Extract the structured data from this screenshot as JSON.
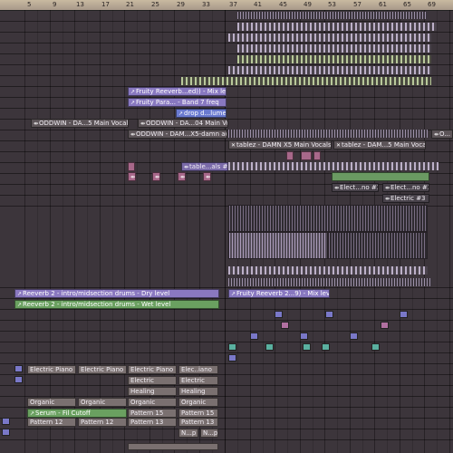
{
  "ruler": {
    "ticks": [
      "5",
      "9",
      "13",
      "17",
      "21",
      "25",
      "29",
      "33",
      "37",
      "41",
      "45",
      "49",
      "53",
      "57",
      "61",
      "65",
      "69"
    ]
  },
  "clips": {
    "mix_level_top": "Fruity Reeverb...ed)) - Mix level",
    "band7": "Fruity Para... - Band 7 freq",
    "drop_volume": "drop d...lume",
    "main_vocals_a": "ODDWIN - DA...5 Main Vocals",
    "main_vocals_b": "ODDWIN - DA...04 Main Vocals",
    "adlibs": "ODDWIN - DAM...X5-damn adlibs",
    "adlibs_end": "O...",
    "tablez_a": "tablez - DAMN X5 Main Vocals",
    "tablez_b": "tablez - DAM...5 Main Vocals",
    "table_als": "table...als #2",
    "elect_no3_a": "Elect...no #3",
    "elect_no3_b": "Elect...no #3",
    "electric3": "Electric #3",
    "dry_level": "Reeverb 2 - intro/midsection drums - Dry level",
    "wet_level": "Reeverb 2 - intro/midsection drums - Wet level",
    "mix_level_mid": "Fruity Reeverb 2...9) - Mix level",
    "electric_piano": "Electric Piano",
    "electric_piano2": "Electric Piano",
    "electric_piano3": "Electric Piano",
    "elec_iano": "Elec..iano",
    "electric": "Electric",
    "electric2": "Electric",
    "healing": "Healing",
    "healing2": "Healing",
    "organic": "Organic",
    "organic2": "Organic",
    "organic3": "Organic",
    "organic4": "Organic",
    "serum": "Serum - Fil Cutoff",
    "pattern12a": "Pattern 12",
    "pattern12b": "Pattern 12",
    "pattern13": "Pattern 13",
    "pattern15a": "Pattern 15",
    "pattern15b": "Pattern 15",
    "pattern13b": "Pattern 13",
    "np1": "N...p",
    "np2": "N...p"
  }
}
